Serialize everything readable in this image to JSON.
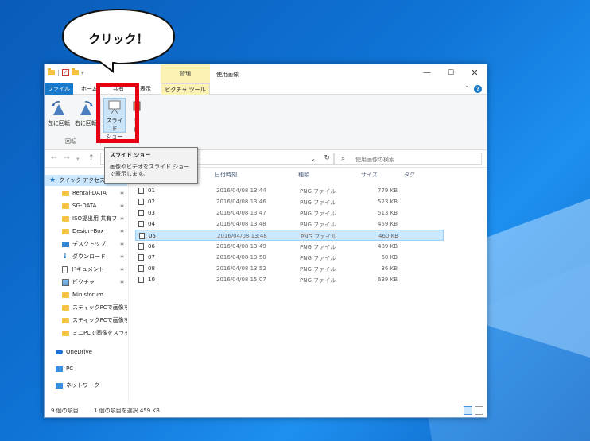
{
  "bubble": {
    "text": "クリック！"
  },
  "window": {
    "title": "使用画像",
    "context_tab_header": "管理",
    "controls": {
      "minimize": "—",
      "maximize": "☐",
      "close": "✕"
    },
    "tabs": [
      {
        "label": "ファイル"
      },
      {
        "label": "ホーム"
      },
      {
        "label": "共有"
      },
      {
        "label": "表示"
      },
      {
        "label": "ピクチャ ツール"
      }
    ],
    "collapse_glyph": "⌃",
    "help_glyph": "?"
  },
  "ribbon": {
    "rotate_left": "左に回転",
    "rotate_right": "右に回転",
    "slideshow_line1": "スライド",
    "slideshow_line2": "ショー",
    "set_desktop_line1": "背",
    "set_desktop_line2": "に",
    "group_label": "回転"
  },
  "tooltip": {
    "title": "スライド ショー",
    "body": "画像やビデオをスライド ショーで表示します。"
  },
  "address": {
    "search_placeholder": "使用画像の検索"
  },
  "nav": {
    "items": [
      {
        "label": "クイック アクセス",
        "icon": "star-icon"
      },
      {
        "label": "Rental-DATA",
        "icon": "folder-icon"
      },
      {
        "label": "SG-DATA",
        "icon": "folder-icon"
      },
      {
        "label": "ISO提出用 共有フ",
        "icon": "folder-icon"
      },
      {
        "label": "Design-Box",
        "icon": "folder-icon"
      },
      {
        "label": "デスクトップ",
        "icon": "desktop-icon"
      },
      {
        "label": "ダウンロード",
        "icon": "download-icon"
      },
      {
        "label": "ドキュメント",
        "icon": "document-icon"
      },
      {
        "label": "ピクチャ",
        "icon": "pictures-icon"
      },
      {
        "label": "Minisforum",
        "icon": "folder-icon"
      },
      {
        "label": "スティックPCで画像をス",
        "icon": "folder-icon"
      },
      {
        "label": "スティックPCで画像をス",
        "icon": "folder-icon"
      },
      {
        "label": "ミニPCで画像をスライド",
        "icon": "folder-icon"
      },
      {
        "label": "OneDrive",
        "icon": "onedrive-icon"
      },
      {
        "label": "PC",
        "icon": "pc-icon"
      },
      {
        "label": "ネットワーク",
        "icon": "network-icon"
      }
    ],
    "pin_glyph": "📌"
  },
  "files": {
    "columns": {
      "date": "日付時刻",
      "type": "種類",
      "size": "サイズ",
      "tag": "タグ"
    },
    "rows": [
      {
        "name": "01",
        "date": "2016/04/08 13:44",
        "type": "PNG ファイル",
        "size": "779 KB"
      },
      {
        "name": "02",
        "date": "2016/04/08 13:46",
        "type": "PNG ファイル",
        "size": "523 KB"
      },
      {
        "name": "03",
        "date": "2016/04/08 13:47",
        "type": "PNG ファイル",
        "size": "513 KB"
      },
      {
        "name": "04",
        "date": "2016/04/08 13:48",
        "type": "PNG ファイル",
        "size": "459 KB"
      },
      {
        "name": "05",
        "date": "2016/04/08 13:48",
        "type": "PNG ファイル",
        "size": "460 KB"
      },
      {
        "name": "06",
        "date": "2016/04/08 13:49",
        "type": "PNG ファイル",
        "size": "489 KB"
      },
      {
        "name": "07",
        "date": "2016/04/08 13:50",
        "type": "PNG ファイル",
        "size": "60 KB"
      },
      {
        "name": "08",
        "date": "2016/04/08 13:52",
        "type": "PNG ファイル",
        "size": "36 KB"
      },
      {
        "name": "10",
        "date": "2016/04/08 15:07",
        "type": "PNG ファイル",
        "size": "639 KB"
      }
    ],
    "selected_index": 4
  },
  "status": {
    "count": "9 個の項目",
    "selection": "1 個の項目を選択  459 KB"
  }
}
